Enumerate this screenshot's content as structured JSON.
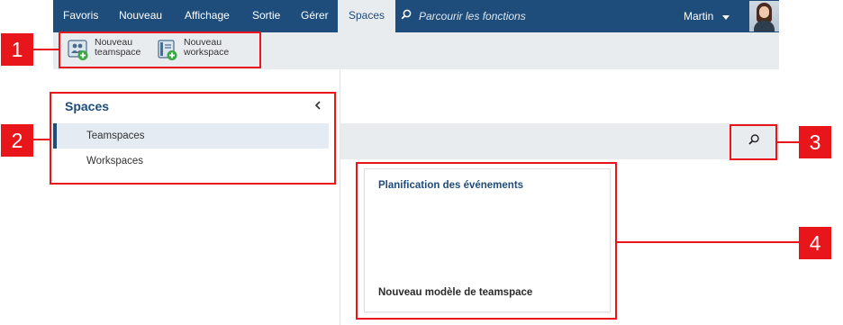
{
  "nav": {
    "items": [
      {
        "label": "Favoris"
      },
      {
        "label": "Nouveau"
      },
      {
        "label": "Affichage"
      },
      {
        "label": "Sortie"
      },
      {
        "label": "Gérer"
      },
      {
        "label": "Spaces"
      }
    ],
    "search_placeholder": "Parcourir les fonctions",
    "user_name": "Martin"
  },
  "ribbon": {
    "new_teamspace": {
      "line1": "Nouveau",
      "line2": "teamspace"
    },
    "new_workspace": {
      "line1": "Nouveau",
      "line2": "workspace"
    }
  },
  "sidebar": {
    "title": "Spaces",
    "items": [
      {
        "label": "Teamspaces",
        "selected": true
      },
      {
        "label": "Workspaces",
        "selected": false
      }
    ]
  },
  "card": {
    "title": "Planification des événements",
    "subtitle": "Nouveau modèle de teamspace"
  },
  "callouts": [
    "1",
    "2",
    "3",
    "4"
  ],
  "colors": {
    "nav_bg": "#1e4d7b",
    "toolbar_bg": "#e9ecef",
    "accent": "#1e4d7b",
    "callout_red": "#e8151b",
    "selected_bg": "#e4ebf2"
  },
  "icons": {
    "search": "search-icon",
    "caret": "chevron-down-icon",
    "collapse": "chevron-left-icon",
    "teamspace": "teamspace-add-icon",
    "workspace": "workspace-add-icon"
  }
}
